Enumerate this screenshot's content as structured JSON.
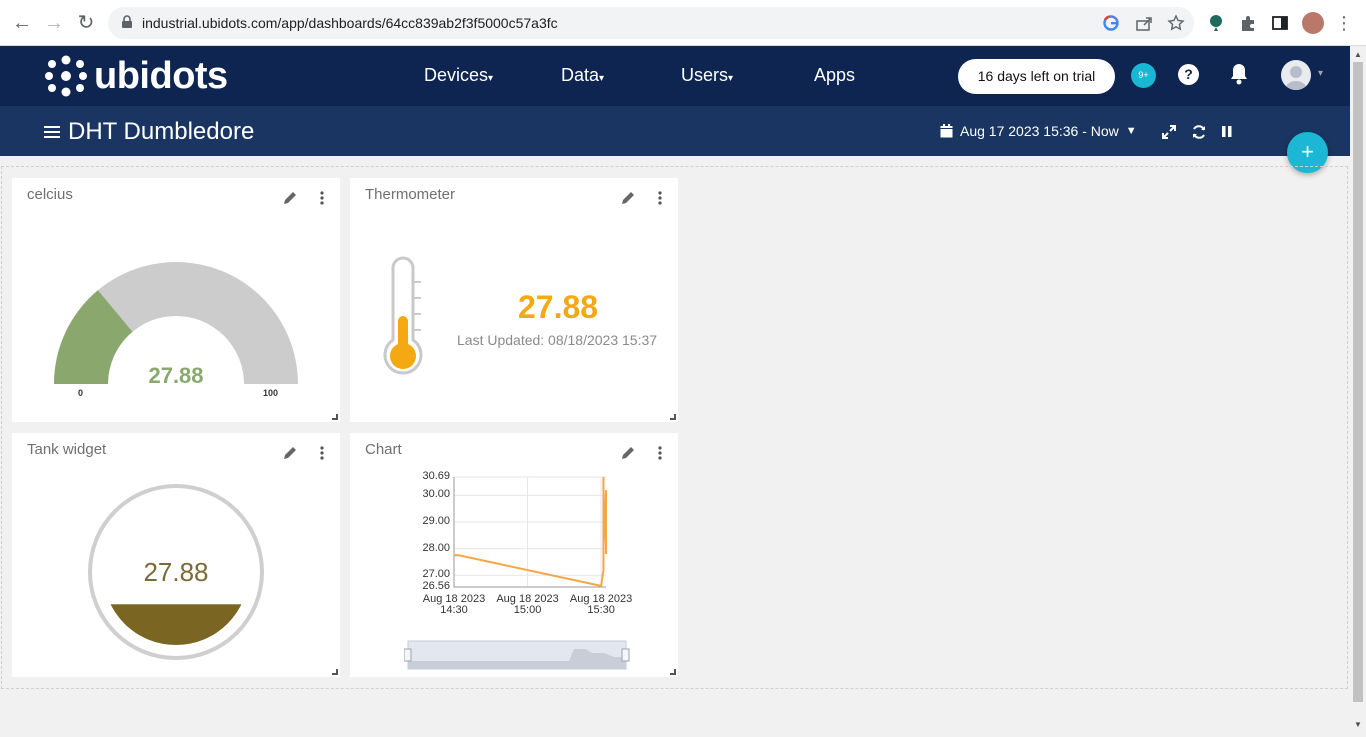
{
  "browser": {
    "url": "industrial.ubidots.com/app/dashboards/64cc839ab2f3f5000c57a3fc"
  },
  "header": {
    "brand": "ubidots",
    "nav": [
      "Devices",
      "Data",
      "Users",
      "Apps"
    ],
    "trial_label": "16 days left on trial",
    "notifications_badge": "9+",
    "help_label": "?"
  },
  "dashboard": {
    "title": "DHT Dumbledore",
    "date_range": "Aug 17 2023 15:36 - Now",
    "add_label": "+"
  },
  "widgets": {
    "gauge": {
      "title": "celcius",
      "value": "27.88",
      "min": "0",
      "max": "100",
      "fraction": 0.2788,
      "color": "#8aa86e"
    },
    "thermometer": {
      "title": "Thermometer",
      "value": "27.88",
      "last_updated": "Last Updated: 08/18/2023 15:37",
      "color": "#f4a812"
    },
    "tank": {
      "title": "Tank widget",
      "value": "27.88",
      "fill_fraction": 0.2788,
      "color": "#7a6622"
    },
    "chart": {
      "title": "Chart"
    }
  },
  "chart_data": {
    "type": "line",
    "title": "",
    "xlabel": "",
    "ylabel": "",
    "yticks": [
      "30.69",
      "30.00",
      "29.00",
      "28.00",
      "27.00",
      "26.56"
    ],
    "xticks": [
      {
        "line1": "Aug 18 2023",
        "line2": "14:30"
      },
      {
        "line1": "Aug 18 2023",
        "line2": "15:00"
      },
      {
        "line1": "Aug 18 2023",
        "line2": "15:30"
      }
    ],
    "ylim": [
      26.56,
      30.69
    ],
    "xlim": [
      "2023-08-18 14:30",
      "2023-08-18 15:32"
    ],
    "series": [
      {
        "color": "#f5a64a",
        "x": [
          "2023-08-18 14:30",
          "2023-08-18 14:32",
          "2023-08-18 15:30",
          "2023-08-18 15:31",
          "2023-08-18 15:31",
          "2023-08-18 15:31",
          "2023-08-18 15:32",
          "2023-08-18 15:32"
        ],
        "y": [
          27.75,
          27.75,
          26.6,
          27.2,
          30.69,
          28.0,
          30.2,
          27.8
        ]
      }
    ],
    "grid": true
  }
}
